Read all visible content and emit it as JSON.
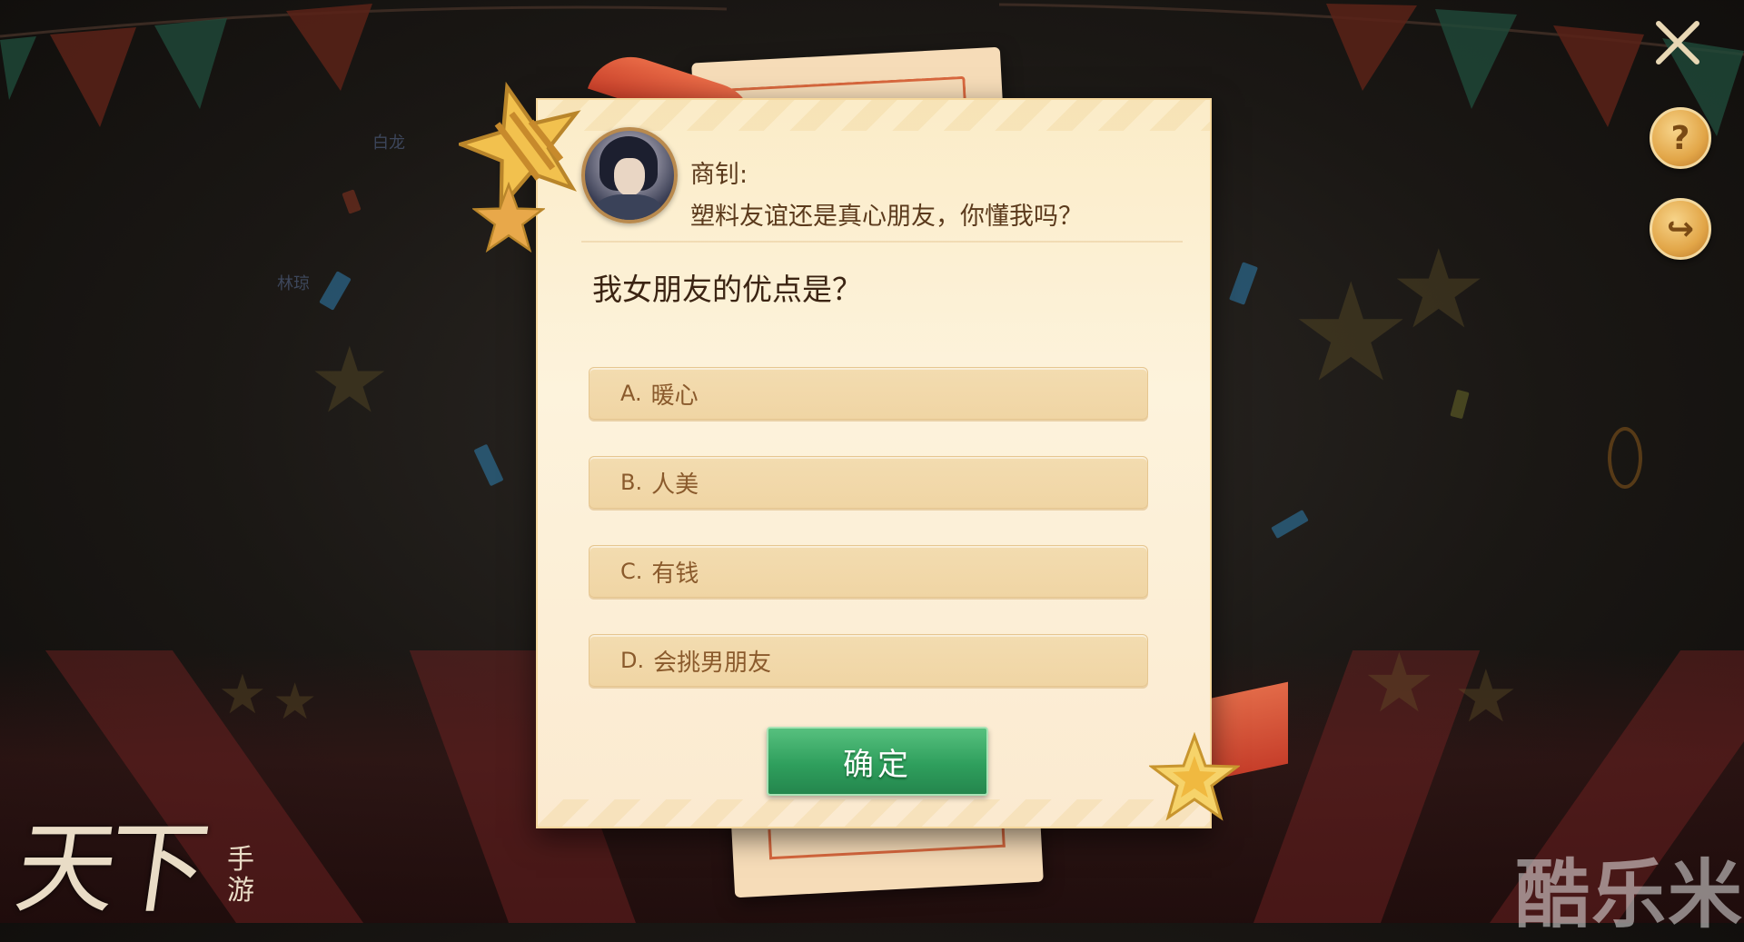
{
  "dialog": {
    "speaker": "商钊:",
    "speech": "塑料友谊还是真心朋友，你懂我吗？",
    "question": "我女朋友的优点是？",
    "options": [
      {
        "letter": "A.",
        "text": "暖心"
      },
      {
        "letter": "B.",
        "text": "人美"
      },
      {
        "letter": "C.",
        "text": "有钱"
      },
      {
        "letter": "D.",
        "text": "会挑男朋友"
      }
    ],
    "confirm_label": "确定"
  },
  "background_names": [
    "林琼",
    "白龙"
  ],
  "side_buttons": {
    "help_glyph": "?",
    "share_glyph": "↪"
  },
  "logo": {
    "main": "天下",
    "sub_line1": "手",
    "sub_line2": "游"
  },
  "watermark": "酷乐米",
  "colors": {
    "confirm_green": "#2f9f5d",
    "option_text": "#8a5a2c",
    "card_bg": "#fdf3dc",
    "ribbon_red": "#c9402a",
    "star_gold": "#f2c14e"
  }
}
